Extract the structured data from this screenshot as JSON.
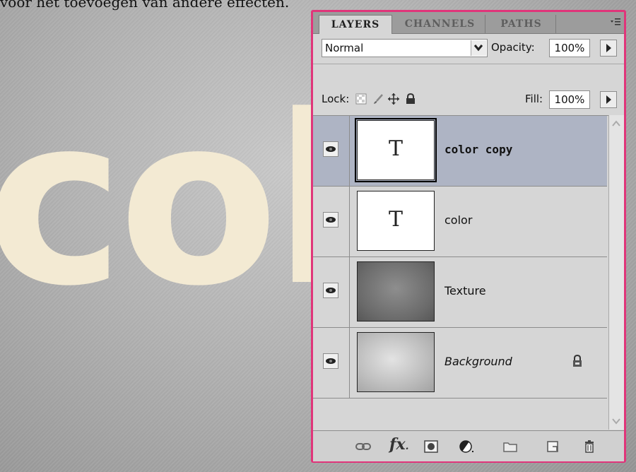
{
  "caption": "voor het toevoegen van andere effecten.",
  "canvas_word": "col",
  "panel": {
    "tabs": [
      {
        "label": "LAYERS",
        "active": true
      },
      {
        "label": "CHANNELS",
        "active": false
      },
      {
        "label": "PATHS",
        "active": false
      }
    ],
    "blend_mode": "Normal",
    "opacity_label": "Opacity:",
    "opacity_value": "100%",
    "lock_label": "Lock:",
    "fill_label": "Fill:",
    "fill_value": "100%",
    "layers": [
      {
        "name": "color copy",
        "thumbnail": "T",
        "selected": true,
        "visible": true
      },
      {
        "name": "color",
        "thumbnail": "T",
        "selected": false,
        "visible": true
      },
      {
        "name": "Texture",
        "thumbnail": "texture-image",
        "selected": false,
        "visible": true
      },
      {
        "name": "Background",
        "thumbnail": "background-image",
        "selected": false,
        "visible": true,
        "locked": true
      }
    ],
    "bottom_icons": [
      "link-layers-icon",
      "fx-icon",
      "add-mask-icon",
      "adjustment-layer-icon",
      "new-group-icon",
      "new-layer-icon",
      "delete-layer-icon"
    ],
    "colors": {
      "highlight_border": "#e0357a",
      "selected_layer": "#aeb4c4"
    }
  }
}
